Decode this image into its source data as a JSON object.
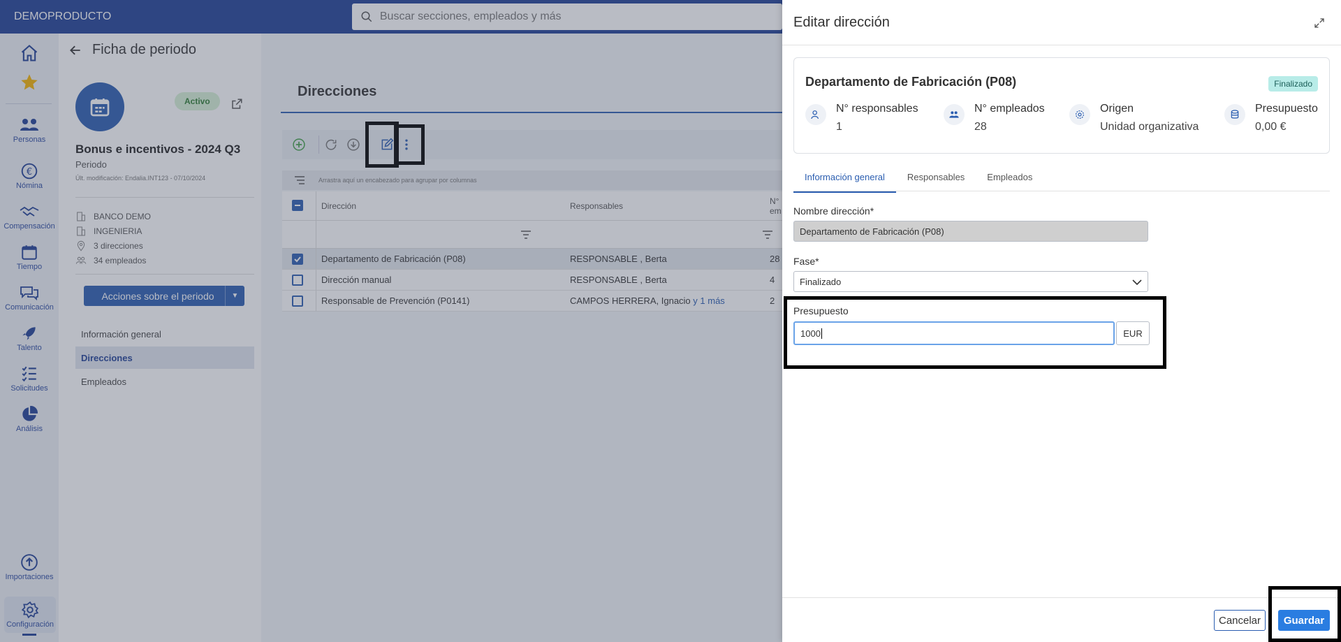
{
  "topbar": {
    "brand": "DEMOPRODUCTO",
    "search_placeholder": "Buscar secciones, empleados y más"
  },
  "nav": {
    "items": [
      {
        "label": ""
      },
      {
        "label": ""
      },
      {
        "label": "Personas"
      },
      {
        "label": "Nómina"
      },
      {
        "label": "Compensación"
      },
      {
        "label": "Tiempo"
      },
      {
        "label": "Comunicación"
      },
      {
        "label": "Talento"
      },
      {
        "label": "Solicitudes"
      },
      {
        "label": "Análisis"
      },
      {
        "label": "Importaciones"
      },
      {
        "label": "Configuración"
      }
    ]
  },
  "period": {
    "page_title": "Ficha de periodo",
    "status": "Activo",
    "name": "Bonus e incentivos - 2024 Q3",
    "type": "Periodo",
    "last_modified": "Últ. modificación: Endalia.INT123 - 07/10/2024",
    "info": [
      "BANCO DEMO",
      "INGENIERIA",
      "3 direcciones",
      "34 empleados"
    ],
    "actions_label": "Acciones sobre el periodo",
    "links": [
      "Información general",
      "Direcciones",
      "Empleados"
    ]
  },
  "main": {
    "title": "Direcciones",
    "group_hint": "Arrastra aquí un encabezado para agrupar por columnas",
    "columns": [
      "Dirección",
      "Responsables",
      "N° em"
    ],
    "rows": [
      {
        "direccion": "Departamento de Fabricación (P08)",
        "responsables": "RESPONSABLE , Berta",
        "more": "",
        "num": "28",
        "selected": true
      },
      {
        "direccion": "Dirección manual",
        "responsables": "RESPONSABLE , Berta",
        "more": "",
        "num": "4",
        "selected": false
      },
      {
        "direccion": "Responsable de Prevención (P0141)",
        "responsables": "CAMPOS HERRERA, Ignacio",
        "more": "y 1 más",
        "num": "2",
        "selected": false
      }
    ]
  },
  "drawer": {
    "title": "Editar dirección",
    "card": {
      "title": "Departamento de Fabricación (P08)",
      "status": "Finalizado",
      "stats": [
        {
          "label": "N° responsables",
          "value": "1"
        },
        {
          "label": "N° empleados",
          "value": "28"
        },
        {
          "label": "Origen",
          "value": "Unidad organizativa"
        },
        {
          "label": "Presupuesto",
          "value": "0,00 €"
        }
      ]
    },
    "tabs": [
      "Información general",
      "Responsables",
      "Empleados"
    ],
    "form": {
      "name_label": "Nombre dirección*",
      "name_value": "Departamento de Fabricación (P08)",
      "phase_label": "Fase*",
      "phase_value": "Finalizado",
      "budget_label": "Presupuesto",
      "budget_value": "1000",
      "currency": "EUR"
    },
    "cancel_label": "Cancelar",
    "save_label": "Guardar"
  },
  "colors": {
    "topbar": "#1f3f95",
    "primary": "#2a5db0",
    "save": "#2a7de1",
    "active_badge": "#d7f0d5",
    "finished_badge": "#b8ece8"
  }
}
